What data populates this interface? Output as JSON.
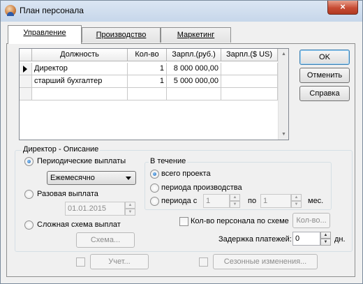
{
  "window": {
    "title": "План персонала",
    "close_glyph": "×"
  },
  "tabs": [
    {
      "label": "Управление",
      "active": true
    },
    {
      "label": "Производство",
      "active": false
    },
    {
      "label": "Маркетинг",
      "active": false
    }
  ],
  "grid": {
    "columns": [
      "Должность",
      "Кол-во",
      "Зарпл.(руб.)",
      "Зарпл.($ US)"
    ],
    "rows": [
      [
        "Директор",
        "1",
        "8 000 000,00",
        ""
      ],
      [
        "старший бухгалтер",
        "1",
        "5 000 000,00",
        ""
      ]
    ],
    "selected_row": 0,
    "scroll_up_icon": "triangle-up-icon",
    "scroll_down_icon": "triangle-down-icon"
  },
  "buttons": {
    "ok": "OK",
    "cancel": "Отменить",
    "help": "Справка"
  },
  "description": {
    "group_label": "Директор - Описание",
    "periodic_label": "Периодические выплаты",
    "frequency_value": "Ежемесячно",
    "one_time_label": "Разовая выплата",
    "one_time_date": "01.01.2015",
    "complex_label": "Сложная схема выплат",
    "scheme_button": "Схема...",
    "selected_payment": "periodic"
  },
  "period": {
    "group_label": "В течение",
    "whole_project": "всего проекта",
    "production_period": "периода производства",
    "from_label": "периода с",
    "from_value": "1",
    "to_label": "по",
    "to_value": "1",
    "months_label": "мес.",
    "selected": "whole_project"
  },
  "staff_scheme": {
    "label": "Кол-во персонала по схеме",
    "button": "Кол-во...",
    "checked": false
  },
  "delay": {
    "label": "Задержка платежей:",
    "value": "0",
    "unit": "дн."
  },
  "bottom": {
    "accounting_button": "Учет...",
    "seasonal_button": "Сезонные изменения..."
  },
  "colors": {
    "accent": "#1b5ea8",
    "close": "#c74b33"
  }
}
